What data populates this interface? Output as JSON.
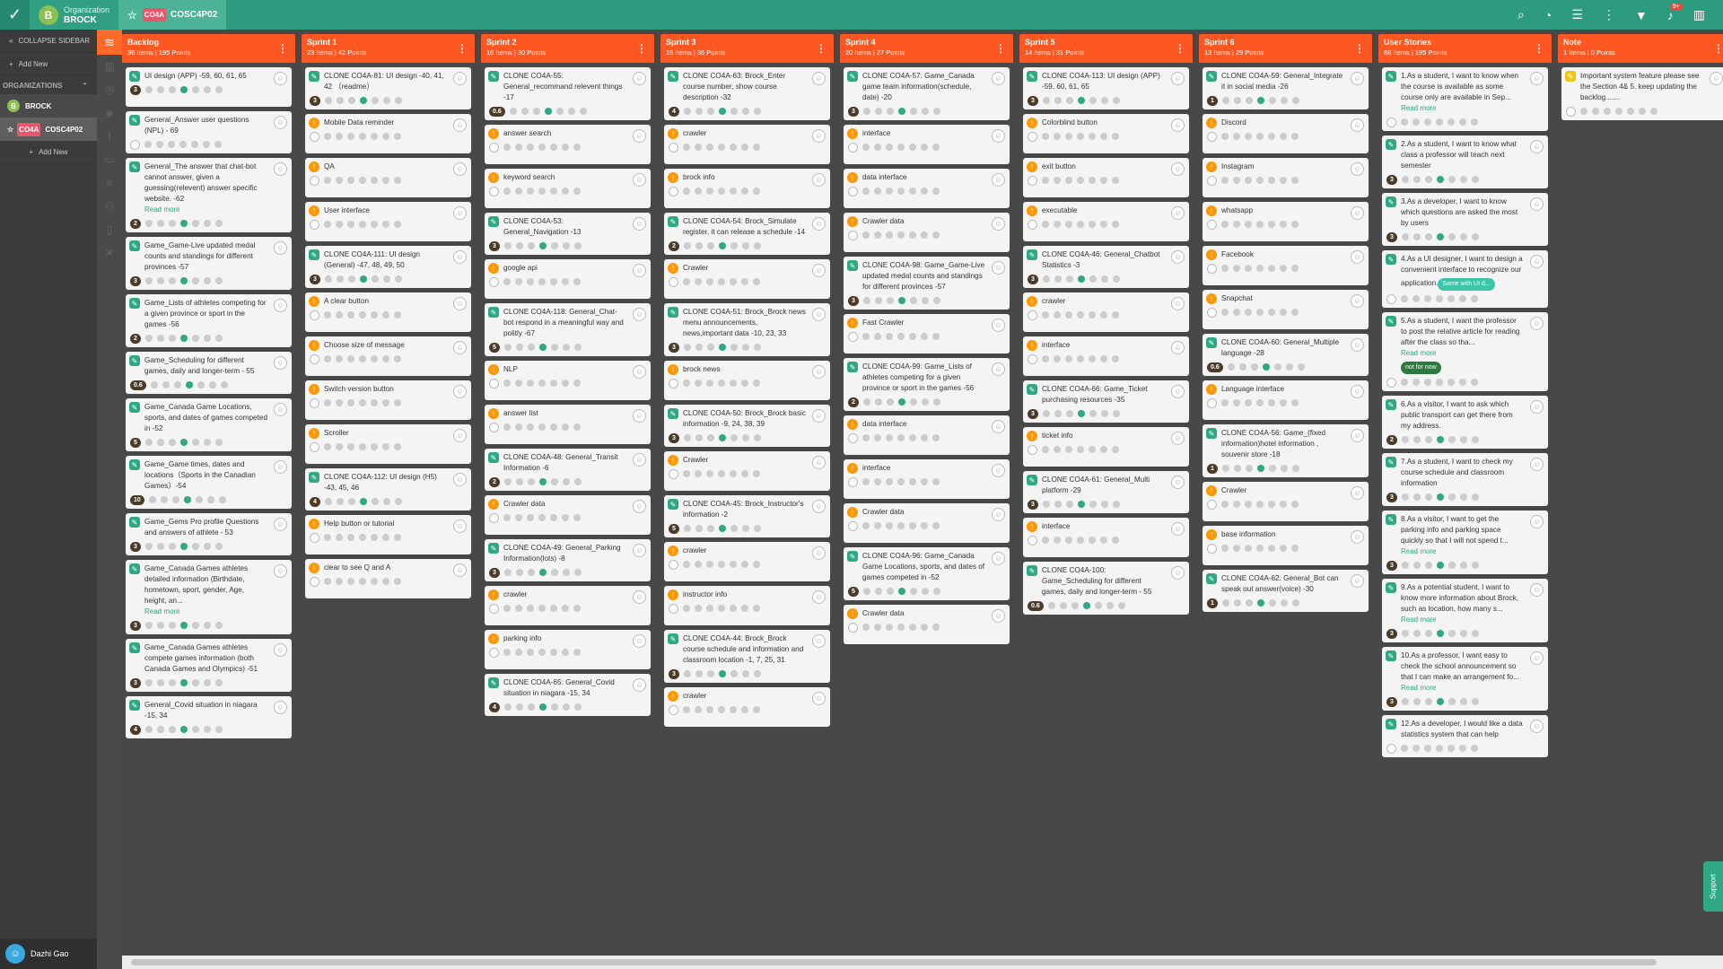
{
  "topbar": {
    "org_label": "Organization",
    "org_name": "BROCK",
    "org_initial": "B",
    "project_code": "CO4A",
    "project_name": "COSC4P02",
    "notif_count": "9+"
  },
  "sidebar": {
    "collapse": "COLLAPSE SIDEBAR",
    "add_new": "Add New",
    "orgs_label": "ORGANIZATIONS",
    "org": "BROCK",
    "project_code": "CO4A",
    "project": "COSC4P02",
    "add_new2": "Add New",
    "user": "Dazhi Gao"
  },
  "columns": [
    {
      "title": "Backlog",
      "stats": "36 Items | 195 Points",
      "cards": [
        {
          "t": "UI design (APP) -59, 60, 61, 65",
          "i": "g",
          "p": "3"
        },
        {
          "t": "General_Answer user questions (NPL) - 69",
          "i": "g",
          "p": ""
        },
        {
          "t": "General_The answer that chat-bot cannot answer, given a guessing(relevent) answer specific website. -62",
          "i": "g",
          "p": "2",
          "rm": "Read more"
        },
        {
          "t": "Game_Game-Live updated medal counts and standings for different provinces -57",
          "i": "g",
          "p": "3"
        },
        {
          "t": "Game_Lists of athletes competing for a given province or sport in the games -56",
          "i": "g",
          "p": "2"
        },
        {
          "t": "Game_Scheduling for different games, daily and longer-term - 55",
          "i": "g",
          "p": "0.6"
        },
        {
          "t": "Game_Canada Game Locations, sports, and dates of games competed in -52",
          "i": "g",
          "p": "5"
        },
        {
          "t": "Game_Game times, dates and locations（Sports in the Canadian Games）-54",
          "i": "g",
          "p": "10"
        },
        {
          "t": "Game_Gems Pro profile Questions and answers of athlete - 53",
          "i": "g",
          "p": "3"
        },
        {
          "t": "Game_Canada Games athletes detailed information (Birthdate, hometown, sport, gender, Age, height, an...",
          "i": "g",
          "p": "3",
          "rm": "Read more"
        },
        {
          "t": "Game_Canada Games athletes compete games information (both Canada Games and Olympics) -51",
          "i": "g",
          "p": "3"
        },
        {
          "t": "General_Covid situation in niagara -15, 34",
          "i": "g",
          "p": "4"
        }
      ]
    },
    {
      "title": "Sprint 1",
      "stats": "23 Items | 42 Points",
      "cards": [
        {
          "t": "CLONE CO4A-81: UI design -40, 41, 42 （readme）",
          "i": "g",
          "p": "3"
        },
        {
          "t": "Mobile Data reminder",
          "i": "o",
          "p": ""
        },
        {
          "t": "QA",
          "i": "o",
          "p": ""
        },
        {
          "t": "User interface",
          "i": "o",
          "p": ""
        },
        {
          "t": "CLONE CO4A-111: UI design (General) -47, 48, 49, 50",
          "i": "g",
          "p": "3"
        },
        {
          "t": "A clear button",
          "i": "o",
          "p": ""
        },
        {
          "t": "Choose size of message",
          "i": "o",
          "p": ""
        },
        {
          "t": "Switch version button",
          "i": "o",
          "p": ""
        },
        {
          "t": "Scroller",
          "i": "o",
          "p": ""
        },
        {
          "t": "CLONE CO4A-112: UI design (H5) -43, 45, 46",
          "i": "g",
          "p": "4"
        },
        {
          "t": "Help button or tutorial",
          "i": "o",
          "p": ""
        },
        {
          "t": "clear to see Q and A",
          "i": "o",
          "p": ""
        }
      ]
    },
    {
      "title": "Sprint 2",
      "stats": "16 Items | 30 Points",
      "cards": [
        {
          "t": "CLONE CO4A-55: General_recommand relevent things -17",
          "i": "g",
          "p": "0.6"
        },
        {
          "t": "answer search",
          "i": "o",
          "p": ""
        },
        {
          "t": "keyword search",
          "i": "o",
          "p": ""
        },
        {
          "t": "CLONE CO4A-53: General_Navigation -13",
          "i": "g",
          "p": "3"
        },
        {
          "t": "google api",
          "i": "o",
          "p": ""
        },
        {
          "t": "CLONE CO4A-118: General_Chat-bot respond in a meaningful way and politly -67",
          "i": "g",
          "p": "5"
        },
        {
          "t": "NLP",
          "i": "o",
          "p": ""
        },
        {
          "t": "answer list",
          "i": "o",
          "p": ""
        },
        {
          "t": "CLONE CO4A-48: General_Transit Information -6",
          "i": "g",
          "p": "2"
        },
        {
          "t": "Crawler data",
          "i": "o",
          "p": ""
        },
        {
          "t": "CLONE CO4A-49: General_Parking Information(lots) -8",
          "i": "g",
          "p": "3"
        },
        {
          "t": "crawler",
          "i": "o",
          "p": ""
        },
        {
          "t": "parking info",
          "i": "o",
          "p": ""
        },
        {
          "t": "CLONE CO4A-65: General_Covid situation in niagara -15, 34",
          "i": "g",
          "p": "4"
        }
      ]
    },
    {
      "title": "Sprint 3",
      "stats": "15 Items | 36 Points",
      "cards": [
        {
          "t": "CLONE CO4A-63: Brock_Enter course number, show course description -32",
          "i": "g",
          "p": "4"
        },
        {
          "t": "crawler",
          "i": "o",
          "p": ""
        },
        {
          "t": "brock info",
          "i": "o",
          "p": ""
        },
        {
          "t": "CLONE CO4A-54: Brock_Simulate register, it can release a schedule -14",
          "i": "g",
          "p": "2"
        },
        {
          "t": "Crawler",
          "i": "o",
          "p": ""
        },
        {
          "t": "CLONE CO4A-51: Brock_Brock news menu announcements, news,important data -10, 23, 33",
          "i": "g",
          "p": "3"
        },
        {
          "t": "brock news",
          "i": "o",
          "p": ""
        },
        {
          "t": "CLONE CO4A-50: Brock_Brock basic information -9, 24, 38, 39",
          "i": "g",
          "p": "3"
        },
        {
          "t": "Crawler",
          "i": "o",
          "p": ""
        },
        {
          "t": "CLONE CO4A-45: Brock_Instructor's information -2",
          "i": "g",
          "p": "5"
        },
        {
          "t": "crawler",
          "i": "o",
          "p": ""
        },
        {
          "t": "instructor info",
          "i": "o",
          "p": ""
        },
        {
          "t": "CLONE CO4A-44: Brock_Brock course schedule and information and classroom location -1, 7, 25, 31",
          "i": "g",
          "p": "3"
        },
        {
          "t": "crawler",
          "i": "o",
          "p": ""
        }
      ]
    },
    {
      "title": "Sprint 4",
      "stats": "20 Items | 27 Points",
      "cards": [
        {
          "t": "CLONE CO4A-57: Game_Canada game team information(schedule, date) -20",
          "i": "g",
          "p": "3"
        },
        {
          "t": "interface",
          "i": "o",
          "p": ""
        },
        {
          "t": "data interface",
          "i": "o",
          "p": ""
        },
        {
          "t": "Crawler data",
          "i": "o",
          "p": ""
        },
        {
          "t": "CLONE CO4A-98: Game_Game-Live updated medal counts and standings for different provinces -57",
          "i": "g",
          "p": "3"
        },
        {
          "t": "Fast Crawler",
          "i": "o",
          "p": ""
        },
        {
          "t": "CLONE CO4A-99: Game_Lists of athletes competing for a given province or sport in the games -56",
          "i": "g",
          "p": "2"
        },
        {
          "t": "data interface",
          "i": "o",
          "p": ""
        },
        {
          "t": "interface",
          "i": "o",
          "p": ""
        },
        {
          "t": "Crawler data",
          "i": "o",
          "p": ""
        },
        {
          "t": "CLONE CO4A-96: Game_Canada Game Locations, sports, and dates of games competed in -52",
          "i": "g",
          "p": "5"
        },
        {
          "t": "Crawler data",
          "i": "o",
          "p": ""
        }
      ]
    },
    {
      "title": "Sprint 5",
      "stats": "14 Items | 31 Points",
      "cards": [
        {
          "t": "CLONE CO4A-113: UI design (APP) -59, 60, 61, 65",
          "i": "g",
          "p": "3"
        },
        {
          "t": "Colorblind button",
          "i": "o",
          "p": ""
        },
        {
          "t": "exit button",
          "i": "o",
          "p": ""
        },
        {
          "t": "executable",
          "i": "o",
          "p": ""
        },
        {
          "t": "CLONE CO4A-46: General_Chatbot Statistics -3",
          "i": "g",
          "p": "3"
        },
        {
          "t": "crawler",
          "i": "o",
          "p": ""
        },
        {
          "t": "interface",
          "i": "o",
          "p": ""
        },
        {
          "t": "CLONE CO4A-66: Game_Ticket purchasing resources -35",
          "i": "g",
          "p": "3"
        },
        {
          "t": "ticket info",
          "i": "o",
          "p": ""
        },
        {
          "t": "CLONE CO4A-61: General_Multi platform -29",
          "i": "g",
          "p": "3"
        },
        {
          "t": "interface",
          "i": "o",
          "p": ""
        },
        {
          "t": "CLONE CO4A-100: Game_Scheduling for different games, daily and longer-term - 55",
          "i": "g",
          "p": "0.6"
        }
      ]
    },
    {
      "title": "Sprint 6",
      "stats": "13 Items | 29 Points",
      "cards": [
        {
          "t": "CLONE CO4A-59: General_Integrate it in social media -26",
          "i": "g",
          "p": "1"
        },
        {
          "t": "Discord",
          "i": "o",
          "p": ""
        },
        {
          "t": "Instagram",
          "i": "o",
          "p": ""
        },
        {
          "t": "whatsapp",
          "i": "o",
          "p": ""
        },
        {
          "t": "Facebook",
          "i": "o",
          "p": ""
        },
        {
          "t": "Snapchat",
          "i": "o",
          "p": ""
        },
        {
          "t": "CLONE CO4A-60: General_Multiple language -28",
          "i": "g",
          "p": "0.6"
        },
        {
          "t": "Language interface",
          "i": "o",
          "p": ""
        },
        {
          "t": "CLONE CO4A-56: Game_(fixed information)hotel information , souvenir store -18",
          "i": "g",
          "p": "1"
        },
        {
          "t": "Crawler",
          "i": "o",
          "p": ""
        },
        {
          "t": "base information",
          "i": "o",
          "p": ""
        },
        {
          "t": "CLONE CO4A-62: General_Bot can speak out answer(voice) -30",
          "i": "g",
          "p": "1"
        }
      ]
    },
    {
      "title": "User Stories",
      "stats": "68 Items | 195 Points",
      "cards": [
        {
          "t": "1.As a student, I want to know when the course is available as some course only are available in Sep...",
          "i": "g",
          "p": "",
          "rm": "Read more"
        },
        {
          "t": "2.As a student, I want to know what class a professor will teach next semester",
          "i": "g",
          "p": "3"
        },
        {
          "t": "3.As a developer, I want to know which questions are asked the most by users",
          "i": "g",
          "p": "3"
        },
        {
          "t": "4.As a UI designer, I want to design a convenient interface to recognize our application.",
          "i": "g",
          "p": "",
          "tag": "Same with UI d...",
          "tagc": "#3cc6a8"
        },
        {
          "t": "5.As a student, I want the professor to post the relative article for reading after the class so tha...",
          "i": "g",
          "p": "",
          "rm": "Read more",
          "tag": "not for now",
          "tagc": "#2d7a3e"
        },
        {
          "t": "6.As a visitor, I want to ask which public transport can get there from my address.",
          "i": "g",
          "p": "2"
        },
        {
          "t": "7.As a student, I want to check my course schedule and classroom information",
          "i": "g",
          "p": "3"
        },
        {
          "t": "8.As a visitor, I want to get the parking info and parking space quickly so that I will not spend t...",
          "i": "g",
          "p": "3",
          "rm": "Read more"
        },
        {
          "t": "9.As a potential student, I want to know more information about Brock, such as location, how many s...",
          "i": "g",
          "p": "3",
          "rm": "Read more"
        },
        {
          "t": "10.As a professor, I want easy to check the school announcement so that I can make an arrangement fo...",
          "i": "g",
          "p": "3",
          "rm": "Read more"
        },
        {
          "t": "12.As a developer, I would like a data statistics system that can help",
          "i": "g",
          "p": ""
        }
      ]
    },
    {
      "title": "Note",
      "stats": "1 Items | 0 Points",
      "cards": [
        {
          "t": "Important system feature please see the Section 4& 5. keep updating the backlog.......",
          "i": "y",
          "p": ""
        }
      ]
    }
  ],
  "support": "Support",
  "colors": {
    "accent": "#ff5722",
    "brand": "#2d9b7e",
    "story": "#2fa884",
    "task": "#ff9800"
  }
}
